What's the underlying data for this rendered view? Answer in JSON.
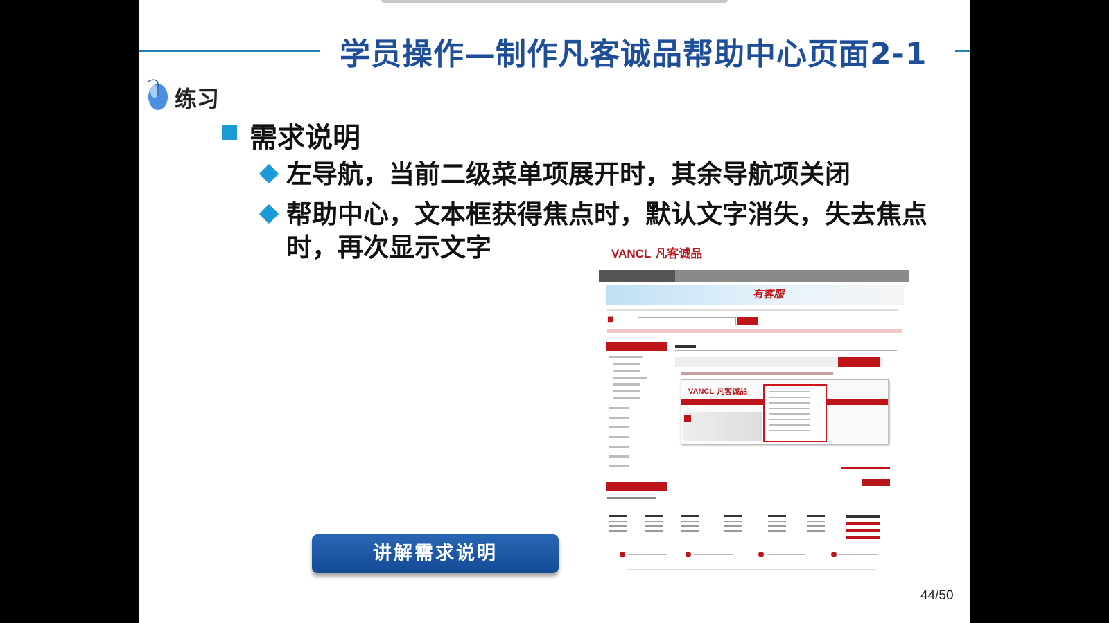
{
  "slide": {
    "title": "学员操作—制作凡客诚品帮助中心页面2-1",
    "practice_label": "练习",
    "heading": "需求说明",
    "bullets": [
      "左导航，当前二级菜单项展开时，其余导航项关闭",
      "帮助中心，文本框获得焦点时，默认文字消失，失去焦点时，再次显示文字"
    ],
    "button_label": "讲解需求说明",
    "page_number": "44/50"
  },
  "screenshot": {
    "logo_brand": "VANCL",
    "logo_cn": "凡客诚品",
    "banner_text": "有客服",
    "inner_logo_brand": "VANCL",
    "inner_logo_cn": "凡客诚品"
  },
  "colors": {
    "title_blue": "#1f4e99",
    "accent_blue": "#1a9ad6",
    "rule_blue": "#1f7fae",
    "vancl_red": "#c0141b",
    "button_blue": "#1a58a6"
  },
  "icons": [
    "mouse-icon",
    "square-bullet-icon",
    "diamond-bullet-icon"
  ]
}
